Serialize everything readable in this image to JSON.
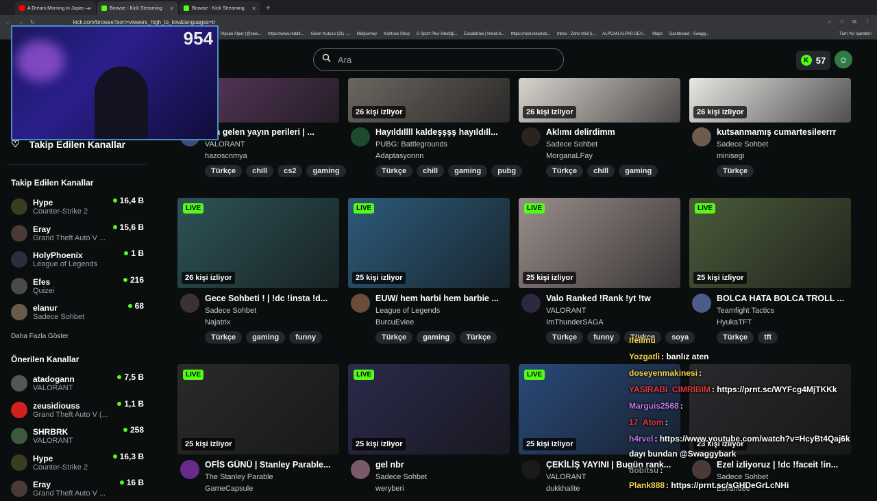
{
  "browser": {
    "tabs": [
      {
        "title": "A Dream Morning in Japan —",
        "favicon_color": "#ff0000"
      },
      {
        "title": "Browse - Kick Streaming",
        "favicon_color": "#53fc18"
      },
      {
        "title": "Browse - Kick Streaming",
        "favicon_color": "#53fc18"
      }
    ],
    "new_tab": "+",
    "url": "kick.com/browse?sort=viewers_high_to_low&languages=tr",
    "bookmarks": [
      "Alpcan Alpar (@swa...",
      "https://www.reddit...",
      "Gelen Kutusu (31) -...",
      "Midjourney",
      "Konfuse Shop",
      "S Sport Plus-İstediği...",
      "Excalidraw | Hand-d...",
      "https://next.inkamat...",
      "Inbox - Zoho Mail (i...",
      "ALPCAN ALPAR DEV...",
      "Maps",
      "Dashboard - Swagg..."
    ],
    "all_bookmarks": "Tüm Yer İşaretleri"
  },
  "webcam": {
    "viewers": "954"
  },
  "header": {
    "search_placeholder": "Ara",
    "points": "57",
    "brand_color": "#53fc18"
  },
  "sidebar": {
    "followed_heading": "Takip Edilen Kanallar",
    "followed_title": "Takip Edilen Kanallar",
    "followed": [
      {
        "name": "Hype",
        "game": "Counter-Strike 2",
        "count": "16,4 B",
        "color": "#3a3d20"
      },
      {
        "name": "Eray",
        "game": "Grand Theft Auto V ...",
        "count": "15,6 B",
        "color": "#4b3a36"
      },
      {
        "name": "HolyPhoenix",
        "game": "League of Legends",
        "count": "1 B",
        "color": "#2a2e3f"
      },
      {
        "name": "Efes",
        "game": "Quizei",
        "count": "216",
        "color": "#4c4a48"
      },
      {
        "name": "elanur",
        "game": "Sadece Sohbet",
        "count": "68",
        "color": "#6b5a4c"
      }
    ],
    "show_more": "Daha Fazla Göster",
    "recommended_title": "Önerilen Kanallar",
    "recommended": [
      {
        "name": "atadogann",
        "game": "VALORANT",
        "count": "7,5 B",
        "color": "#4e5a53"
      },
      {
        "name": "zeusidiouss",
        "game": "Grand Theft Auto V (...",
        "count": "1,1 B",
        "color": "#d0201f"
      },
      {
        "name": "SHRBRK",
        "game": "VALORANT",
        "count": "258",
        "color": "#3d5a3e"
      },
      {
        "name": "Hype",
        "game": "Counter-Strike 2",
        "count": "16,3 B",
        "color": "#3a3d20"
      },
      {
        "name": "Eray",
        "game": "Grand Theft Auto V ...",
        "count": "16 B",
        "color": "#4b3a36"
      }
    ]
  },
  "streams": [
    {
      "live": "",
      "viewers": "izliyor",
      "title": "den gelen yayın perileri | ...",
      "category": "VALORANT",
      "channel": "hazoscnmya",
      "tags": [
        "Türkçe",
        "chill",
        "cs2",
        "gaming"
      ],
      "thumb": "#5a3a5e",
      "avatar": "#3b4d74"
    },
    {
      "live": "",
      "viewers": "26 kişi izliyor",
      "title": "Hayıldıllll kaldeşşşş hayıldıll...",
      "category": "PUBG: Battlegrounds",
      "channel": "Adaptasyonnn",
      "tags": [
        "Türkçe",
        "chill",
        "gaming",
        "pubg"
      ],
      "thumb": "#6b6660",
      "avatar": "#1d4a2e"
    },
    {
      "live": "",
      "viewers": "26 kişi izliyor",
      "title": "Aklımı delirdimm",
      "category": "Sadece Sohbet",
      "channel": "MorganaLFay",
      "tags": [
        "Türkçe",
        "chill",
        "gaming"
      ],
      "thumb": "#d8d3cd",
      "avatar": "#2b2320"
    },
    {
      "live": "",
      "viewers": "26 kişi izliyor",
      "title": "kutsanmamış cumartesileerrr",
      "category": "Sadece Sohbet",
      "channel": "minisegi",
      "tags": [
        "Türkçe"
      ],
      "thumb": "#e9e7e4",
      "avatar": "#6e5b4d"
    },
    {
      "live": "LIVE",
      "viewers": "26 kişi izliyor",
      "title": "Gece Sohbeti ! | !dc !insta !d...",
      "category": "Sadece Sohbet",
      "channel": "Najatrix",
      "tags": [
        "Türkçe",
        "gaming",
        "funny"
      ],
      "thumb": "#2d5357",
      "avatar": "#3a3230"
    },
    {
      "live": "LIVE",
      "viewers": "25 kişi izliyor",
      "title": "EUW/ hem harbi hem barbie ...",
      "category": "League of Legends",
      "channel": "BurcuEviee",
      "tags": [
        "Türkçe",
        "gaming",
        "Türkçe"
      ],
      "thumb": "#2d5b7a",
      "avatar": "#6b4b3a"
    },
    {
      "live": "LIVE",
      "viewers": "25 kişi izliyor",
      "title": "Valo Ranked !Rank !yt !tw",
      "category": "VALORANT",
      "channel": "ImThunderSAGA",
      "tags": [
        "Türkçe",
        "funny",
        "Türkçe",
        "soya"
      ],
      "thumb": "#9a8e8c",
      "avatar": "#2d2740"
    },
    {
      "live": "LIVE",
      "viewers": "25 kişi izliyor",
      "title": "BOLCA HATA BOLCA TROLL ...",
      "category": "Teamfight Tactics",
      "channel": "HyukaTFT",
      "tags": [
        "Türkçe",
        "tft"
      ],
      "thumb": "#4a5a3a",
      "avatar": "#4b5b8a"
    },
    {
      "live": "LIVE",
      "viewers": "25 kişi izliyor",
      "title": "OFİS GÜNÜ | Stanley Parable...",
      "category": "The Stanley Parable",
      "channel": "GameCapsule",
      "tags": [],
      "thumb": "#2a2a2a",
      "avatar": "#6a2a8a"
    },
    {
      "live": "LIVE",
      "viewers": "25 kişi izliyor",
      "title": "gel nbr",
      "category": "Sadece Sohbet",
      "channel": "weryberi",
      "tags": [],
      "thumb": "#2b2a4a",
      "avatar": "#7a5a6a"
    },
    {
      "live": "LIVE",
      "viewers": "25 kişi izliyor",
      "title": "ÇEKİLİŞ YAYINI | Bugün rank...",
      "category": "VALORANT",
      "channel": "dukkhalite",
      "tags": [],
      "thumb": "#2a4a7a",
      "avatar": "#1a1a1a"
    },
    {
      "live": "",
      "viewers": "23 kişi izliyor",
      "title": "Ezel izliyoruz | !dc !faceit !in...",
      "category": "Sadece Sohbet",
      "channel": "Esvandee",
      "tags": [],
      "thumb": "#2a2a2e",
      "avatar": "#4a3a3a"
    }
  ],
  "chat": [
    {
      "user": "Ifeilmu",
      "msg": "",
      "color": "#f5d44a"
    },
    {
      "user": "Yozgatli",
      "msg": ": banlız aten",
      "color": "#f5d44a"
    },
    {
      "user": "doseyenmakinesi",
      "msg": ":",
      "color": "#f5d44a"
    },
    {
      "user": "YASIRABI_CIMRIBIM",
      "msg": ": https://prnt.sc/WYFcg4MjTKKk",
      "color": "#e0383e"
    },
    {
      "user": "Marguis2568",
      "msg": ":",
      "color": "#c07be8"
    },
    {
      "user": "17_Atom",
      "msg": ":",
      "color": "#e0383e"
    },
    {
      "user": "h4rvel",
      "msg": ": https://www.youtube.com/watch?v=HcyBt4Qaj6k",
      "color": "#c07be8"
    },
    {
      "user": "",
      "msg": "dayı bundan @Swaggybark",
      "color": "#ffffff"
    },
    {
      "user": "dobitsu",
      "msg": ":",
      "color": "#888888"
    },
    {
      "user": "Plank888",
      "msg": ": https://prnt.sc/sGHDeGrLcNHi",
      "color": "#f5d44a"
    }
  ]
}
